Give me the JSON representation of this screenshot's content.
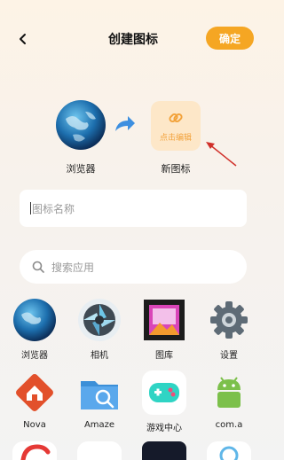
{
  "header": {
    "title": "创建图标",
    "confirm_label": "确定"
  },
  "preview": {
    "source_label": "浏览器",
    "new_icon_edit_text": "点击编辑",
    "new_label": "新图标"
  },
  "name_input": {
    "placeholder": "图标名称"
  },
  "search": {
    "placeholder": "搜索应用"
  },
  "apps": [
    {
      "label": "浏览器",
      "icon": "browser-globe-icon"
    },
    {
      "label": "相机",
      "icon": "camera-aperture-icon"
    },
    {
      "label": "图库",
      "icon": "gallery-icon"
    },
    {
      "label": "设置",
      "icon": "settings-gear-icon"
    },
    {
      "label": "Nova",
      "icon": "nova-launcher-icon"
    },
    {
      "label": "Amaze",
      "icon": "amaze-folder-icon"
    },
    {
      "label": "游戏中心",
      "icon": "game-controller-icon"
    },
    {
      "label": "com.a",
      "icon": "android-robot-icon"
    }
  ],
  "colors": {
    "accent": "#f5a623",
    "edit_bg": "#fde7c8",
    "edit_text": "#f2a23a",
    "annotation_arrow": "#d0302a"
  }
}
